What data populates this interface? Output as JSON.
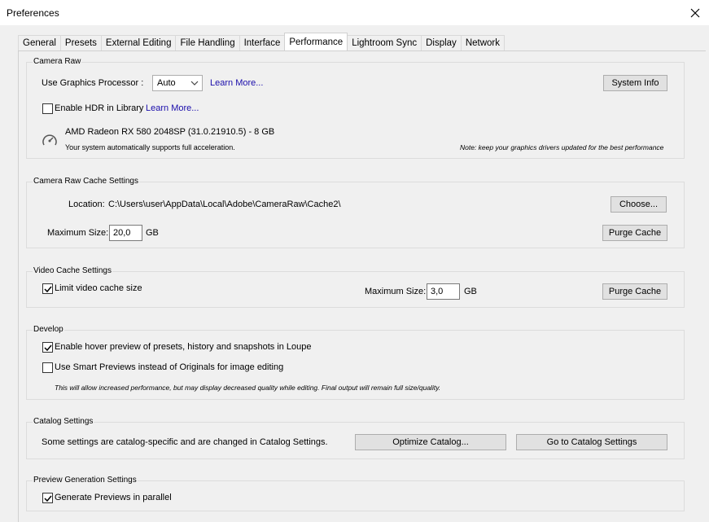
{
  "window": {
    "title": "Preferences"
  },
  "tabs": [
    "General",
    "Presets",
    "External Editing",
    "File Handling",
    "Interface",
    "Performance",
    "Lightroom Sync",
    "Display",
    "Network"
  ],
  "camera_raw": {
    "group_label": "Camera Raw",
    "gpu_label": "Use Graphics Processor :",
    "gpu_value": "Auto",
    "learn_more": "Learn More...",
    "system_info": "System Info",
    "hdr_label": "Enable HDR in Library",
    "hdr_learn_more": "Learn More...",
    "gpu_name": "AMD Radeon RX 580 2048SP (31.0.21910.5) - 8 GB",
    "accel_text": "Your system automatically supports full acceleration.",
    "note": "Note: keep your graphics drivers updated for the best performance"
  },
  "cache": {
    "group_label": "Camera Raw Cache Settings",
    "location_label": "Location:",
    "location_value": "C:\\Users\\user\\AppData\\Local\\Adobe\\CameraRaw\\Cache2\\",
    "choose": "Choose...",
    "max_label": "Maximum Size:",
    "max_value": "20,0",
    "unit": "GB",
    "purge": "Purge Cache"
  },
  "video": {
    "group_label": "Video Cache Settings",
    "limit_label": "Limit video cache size",
    "max_label": "Maximum Size:",
    "max_value": "3,0",
    "unit": "GB",
    "purge": "Purge Cache"
  },
  "develop": {
    "group_label": "Develop",
    "hover_label": "Enable hover preview of presets, history and snapshots in Loupe",
    "smart_label": "Use Smart Previews instead of Originals for image editing",
    "smart_note": "This will allow increased performance, but may display decreased quality while editing. Final output will remain full size/quality."
  },
  "catalog": {
    "group_label": "Catalog Settings",
    "text": "Some settings are catalog-specific and are changed in Catalog Settings.",
    "optimize": "Optimize Catalog...",
    "goto": "Go to Catalog Settings"
  },
  "preview": {
    "group_label": "Preview Generation Settings",
    "parallel_label": "Generate Previews in parallel"
  }
}
